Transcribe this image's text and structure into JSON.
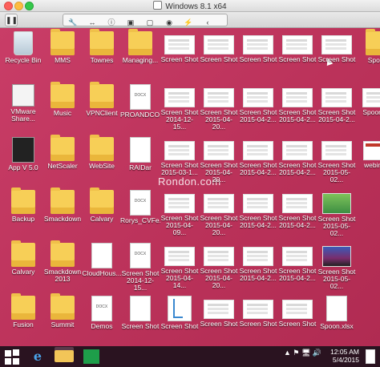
{
  "window": {
    "title": "Windows 8.1 x64"
  },
  "toolbar": {
    "pause_icon": "pause-icon",
    "group_icons": [
      "wrench-icon",
      "arrows-icon",
      "info-icon",
      "display-icon",
      "screen-icon",
      "camera-icon",
      "usb-icon",
      "chevron-icon"
    ],
    "group_glyphs": [
      "🔧",
      "↔",
      "ⓘ",
      "▣",
      "▢",
      "◉",
      "⚡",
      "‹"
    ]
  },
  "desktop": {
    "watermark": "Rondon.com",
    "icons": [
      {
        "label": "Recycle Bin",
        "kind": "bin"
      },
      {
        "label": "MMS",
        "kind": "folder"
      },
      {
        "label": "Townes",
        "kind": "folder"
      },
      {
        "label": "Managing...",
        "kind": "folder"
      },
      {
        "label": "Screen Shot",
        "kind": "thumb"
      },
      {
        "label": "Screen Shot",
        "kind": "thumb"
      },
      {
        "label": "Screen Shot",
        "kind": "thumb"
      },
      {
        "label": "Screen Shot",
        "kind": "thumb"
      },
      {
        "label": "Screen Shot",
        "kind": "thumb"
      },
      {
        "label": "Spoon",
        "kind": "folder"
      },
      {
        "label": "VMware\nShare...",
        "kind": "app"
      },
      {
        "label": "Music",
        "kind": "folder"
      },
      {
        "label": "VPNClient",
        "kind": "folder"
      },
      {
        "label": "PROANDCO...",
        "kind": "docx"
      },
      {
        "label": "Screen Shot\n2014-12-15...",
        "kind": "thumb"
      },
      {
        "label": "Screen Shot\n2015-04-20...",
        "kind": "thumb"
      },
      {
        "label": "Screen Shot\n2015-04-2...",
        "kind": "thumb"
      },
      {
        "label": "Screen Shot\n2015-04-2...",
        "kind": "thumb"
      },
      {
        "label": "Screen Shot\n2015-04-2...",
        "kind": "thumb"
      },
      {
        "label": "SpoonS...",
        "kind": "thumb"
      },
      {
        "label": "App V 5.0",
        "kind": "dark"
      },
      {
        "label": "NetScaler",
        "kind": "folder"
      },
      {
        "label": "WebSite",
        "kind": "folder"
      },
      {
        "label": "RAIDar",
        "kind": "doc"
      },
      {
        "label": "Screen Shot\n2015-03-1...",
        "kind": "thumb"
      },
      {
        "label": "Screen Shot\n2015-04-20...",
        "kind": "thumb"
      },
      {
        "label": "Screen Shot\n2015-04-2...",
        "kind": "thumb"
      },
      {
        "label": "Screen Shot\n2015-04-2...",
        "kind": "thumb"
      },
      {
        "label": "Screen Shot\n2015-05-02...",
        "kind": "thumb"
      },
      {
        "label": "webina...",
        "kind": "red"
      },
      {
        "label": "Backup",
        "kind": "folder"
      },
      {
        "label": "Smackdown",
        "kind": "folder"
      },
      {
        "label": "Calvary",
        "kind": "folder"
      },
      {
        "label": "Rorys_CVFe...",
        "kind": "docx"
      },
      {
        "label": "Screen Shot\n2015-04-09...",
        "kind": "thumb"
      },
      {
        "label": "Screen Shot\n2015-04-20...",
        "kind": "thumb"
      },
      {
        "label": "Screen Shot\n2015-04-2...",
        "kind": "thumb"
      },
      {
        "label": "Screen Shot\n2015-04-2...",
        "kind": "thumb"
      },
      {
        "label": "Screen Shot\n2015-05-02...",
        "kind": "green"
      },
      {
        "label": "",
        "kind": "none"
      },
      {
        "label": "Calvary",
        "kind": "folder"
      },
      {
        "label": "Smackdown\n2013",
        "kind": "folder"
      },
      {
        "label": "CloudHous...",
        "kind": "doc"
      },
      {
        "label": "Screen Shot\n2014-12-15...",
        "kind": "docx"
      },
      {
        "label": "Screen Shot\n2015-04-14...",
        "kind": "thumb"
      },
      {
        "label": "Screen Shot\n2015-04-20...",
        "kind": "thumb"
      },
      {
        "label": "Screen Shot\n2015-04-2...",
        "kind": "thumb"
      },
      {
        "label": "Screen Shot\n2015-04-2...",
        "kind": "thumb"
      },
      {
        "label": "Screen Shot\n2015-05-02...",
        "kind": "photo"
      },
      {
        "label": "",
        "kind": "none"
      },
      {
        "label": "Fusion",
        "kind": "folder"
      },
      {
        "label": "Summit",
        "kind": "folder"
      },
      {
        "label": "Demos",
        "kind": "docx"
      },
      {
        "label": "Screen Shot",
        "kind": "doc"
      },
      {
        "label": "Screen Shot",
        "kind": "map"
      },
      {
        "label": "Screen Shot",
        "kind": "thumb"
      },
      {
        "label": "Screen Shot",
        "kind": "thumb"
      },
      {
        "label": "Screen Shot",
        "kind": "thumb"
      },
      {
        "label": "Spoon.xlsx",
        "kind": "doc"
      },
      {
        "label": "",
        "kind": "none"
      }
    ]
  },
  "taskbar": {
    "items": [
      {
        "name": "start-button",
        "glyph": ""
      },
      {
        "name": "internet-explorer-icon",
        "glyph": "e"
      },
      {
        "name": "file-explorer-icon",
        "glyph": ""
      },
      {
        "name": "store-icon",
        "glyph": ""
      }
    ],
    "tray_glyphs": "▲ ⚑ 🖥 🔊",
    "time": "12:05 AM",
    "date": "5/4/2015"
  }
}
